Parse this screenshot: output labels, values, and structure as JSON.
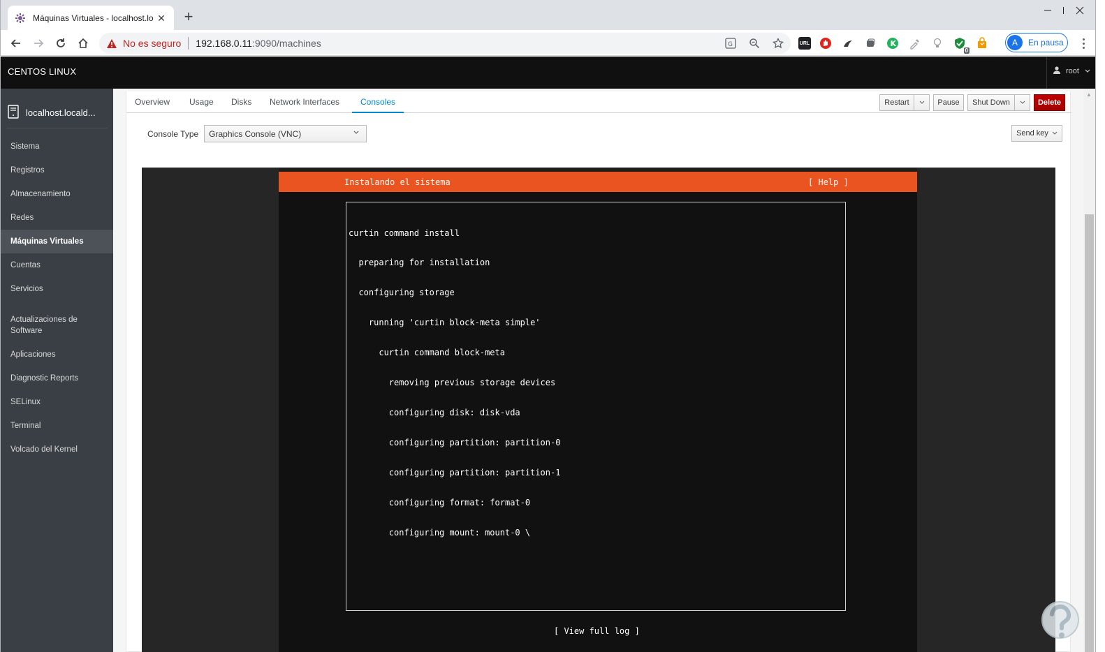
{
  "browser": {
    "tab_title": "Máquinas Virtuales - localhost.lo",
    "security_label": "No es seguro",
    "url_host": "192.168.0.11",
    "url_rest": ":9090/machines",
    "ext_url_label": "URL",
    "ext_badge_count": "0",
    "profile_initial": "A",
    "profile_label": "En pausa"
  },
  "masthead": {
    "brand": "CENTOS LINUX",
    "user": "root"
  },
  "sidebar": {
    "host": "localhost.locald...",
    "items": [
      {
        "label": "Sistema"
      },
      {
        "label": "Registros"
      },
      {
        "label": "Almacenamiento"
      },
      {
        "label": "Redes"
      },
      {
        "label": "Máquinas Virtuales",
        "active": true
      },
      {
        "label": "Cuentas"
      },
      {
        "label": "Servicios"
      },
      {
        "label": "Actualizaciones de Software"
      },
      {
        "label": "Aplicaciones"
      },
      {
        "label": "Diagnostic Reports"
      },
      {
        "label": "SELinux"
      },
      {
        "label": "Terminal"
      },
      {
        "label": "Volcado del Kernel"
      }
    ]
  },
  "vm": {
    "tabs": [
      "Overview",
      "Usage",
      "Disks",
      "Network Interfaces",
      "Consoles"
    ],
    "active_tab": "Consoles",
    "actions": {
      "restart": "Restart",
      "pause": "Pause",
      "shutdown": "Shut Down",
      "delete": "Delete"
    },
    "console_type_label": "Console Type",
    "console_type_value": "Graphics Console (VNC)",
    "send_key": "Send key"
  },
  "console": {
    "header_title": "Instalando el sistema",
    "header_help": "[ Help ]",
    "log_lines": [
      "curtin command install",
      "  preparing for installation",
      "  configuring storage",
      "    running 'curtin block-meta simple'",
      "      curtin command block-meta",
      "        removing previous storage devices",
      "        configuring disk: disk-vda",
      "        configuring partition: partition-0",
      "        configuring partition: partition-1",
      "        configuring format: format-0",
      "        configuring mount: mount-0 \\"
    ],
    "view_full_log": "[ View full log ]"
  },
  "colors": {
    "accent": "#0088ce",
    "danger": "#a30000",
    "installer_orange": "#e95420",
    "sidebar_bg": "#393f44"
  }
}
